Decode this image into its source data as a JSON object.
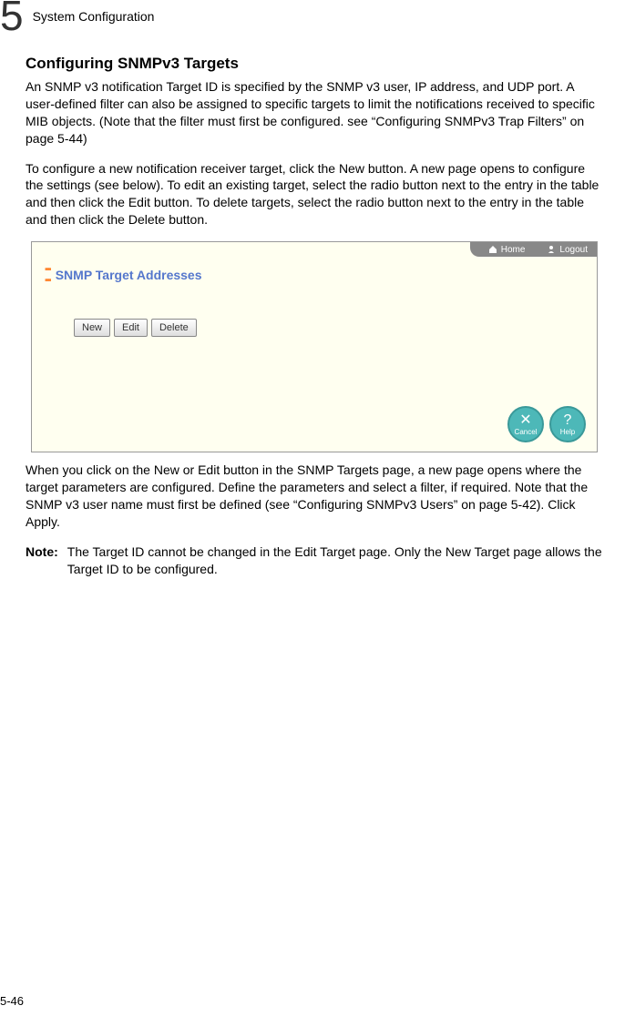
{
  "header": {
    "chapter_number": "5",
    "chapter_title": "System Configuration"
  },
  "section": {
    "title": "Configuring SNMPv3 Targets",
    "para1": "An SNMP v3 notification Target ID is specified by the SNMP v3 user, IP address, and UDP port. A user-defined filter can also be assigned to specific targets to limit the notifications received to specific MIB objects. (Note that the filter must first be configured. see “Configuring SNMPv3 Trap Filters” on page 5-44)",
    "para2": "To configure a new notification receiver target, click the New button. A new page opens to configure the settings (see below). To edit an existing target, select the radio button next to the entry in the table and then click the Edit button. To delete targets, select the radio button next to the entry in the table and then click the Delete button.",
    "para3": "When you click on the New or Edit button in the SNMP Targets page, a new page opens where the target parameters are configured. Define the parameters and select a filter, if required. Note that the SNMP v3 user name must first be defined (see “Configuring SNMPv3 Users” on page 5-42). Click Apply.",
    "note_label": "Note:",
    "note_text": "The Target ID cannot be changed in the Edit Target page. Only the New Target page allows the Target ID to be configured."
  },
  "screenshot": {
    "top_links": {
      "home": "Home",
      "logout": "Logout"
    },
    "panel_title": "SNMP Target Addresses",
    "buttons": {
      "new": "New",
      "edit": "Edit",
      "delete": "Delete"
    },
    "actions": {
      "cancel": "Cancel",
      "help": "Help"
    }
  },
  "footer": {
    "page_number": "5-46"
  }
}
